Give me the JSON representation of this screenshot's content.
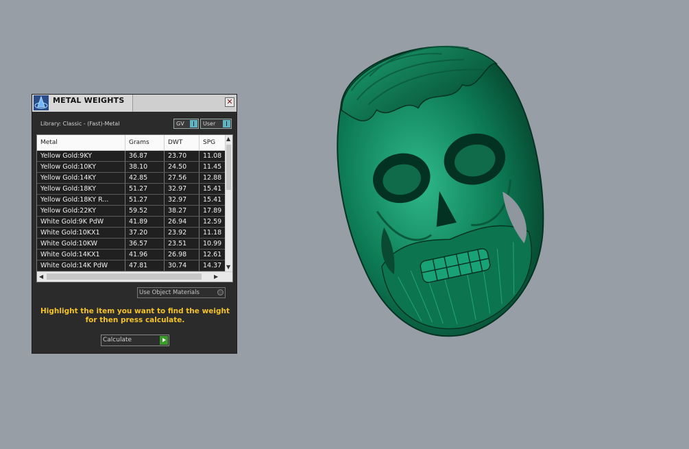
{
  "panel": {
    "title": "METAL WEIGHTS",
    "close_label": "✕",
    "library": "Library: Classic - (Fast)-Metal",
    "toggles": {
      "gv": "GV",
      "user": "User"
    },
    "columns": [
      "Metal",
      "Grams",
      "DWT",
      "SPG"
    ],
    "rows": [
      {
        "metal": "Yellow Gold:9KY",
        "grams": "36.87",
        "dwt": "23.70",
        "spg": "11.08"
      },
      {
        "metal": "Yellow Gold:10KY",
        "grams": "38.10",
        "dwt": "24.50",
        "spg": "11.45"
      },
      {
        "metal": "Yellow Gold:14KY",
        "grams": "42.85",
        "dwt": "27.56",
        "spg": "12.88"
      },
      {
        "metal": "Yellow Gold:18KY",
        "grams": "51.27",
        "dwt": "32.97",
        "spg": "15.41"
      },
      {
        "metal": "Yellow Gold:18KY R...",
        "grams": "51.27",
        "dwt": "32.97",
        "spg": "15.41"
      },
      {
        "metal": "Yellow Gold:22KY",
        "grams": "59.52",
        "dwt": "38.27",
        "spg": "17.89"
      },
      {
        "metal": "White Gold:9K PdW",
        "grams": "41.89",
        "dwt": "26.94",
        "spg": "12.59"
      },
      {
        "metal": "White Gold:10KX1",
        "grams": "37.20",
        "dwt": "23.92",
        "spg": "11.18"
      },
      {
        "metal": "White Gold:10KW",
        "grams": "36.57",
        "dwt": "23.51",
        "spg": "10.99"
      },
      {
        "metal": "White Gold:14KX1",
        "grams": "41.96",
        "dwt": "26.98",
        "spg": "12.61"
      },
      {
        "metal": "White Gold:14K PdW",
        "grams": "47.81",
        "dwt": "30.74",
        "spg": "14.37"
      }
    ],
    "use_object_materials": "Use Object Materials",
    "hint": "Highlight the item you want to find the weight for then press calculate.",
    "calculate": "Calculate"
  },
  "colors": {
    "viewport_bg": "#979ea6",
    "model_green": "#0f7a55",
    "hint_yellow": "#f4c22a"
  }
}
